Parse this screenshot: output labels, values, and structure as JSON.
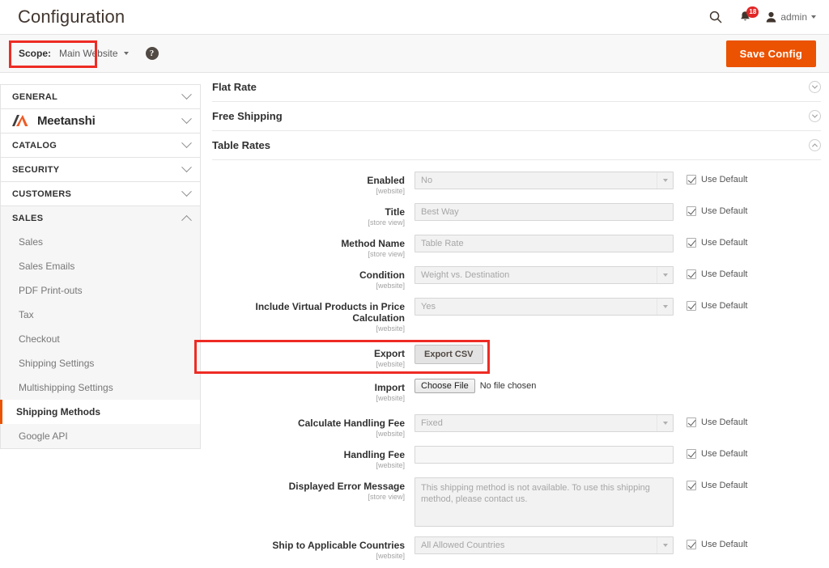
{
  "header": {
    "title": "Configuration",
    "search_icon": "search-icon",
    "notifications_icon": "bell-icon",
    "notification_count": "18",
    "user_icon": "user-icon",
    "user_label": "admin"
  },
  "scope_bar": {
    "label": "Scope:",
    "value": "Main Website",
    "help_icon": "question-mark-icon",
    "save_label": "Save Config",
    "accent_color": "#eb5202",
    "highlight_color": "#ee2b24"
  },
  "sidebar": {
    "sections": [
      {
        "label": "GENERAL",
        "expanded": false
      },
      {
        "label": "Meetanshi",
        "expanded": false,
        "is_logo": true
      },
      {
        "label": "CATALOG",
        "expanded": false
      },
      {
        "label": "SECURITY",
        "expanded": false
      },
      {
        "label": "CUSTOMERS",
        "expanded": false
      },
      {
        "label": "SALES",
        "expanded": true
      }
    ],
    "sales_items": [
      {
        "label": "Sales",
        "active": false
      },
      {
        "label": "Sales Emails",
        "active": false
      },
      {
        "label": "PDF Print-outs",
        "active": false
      },
      {
        "label": "Tax",
        "active": false
      },
      {
        "label": "Checkout",
        "active": false
      },
      {
        "label": "Shipping Settings",
        "active": false
      },
      {
        "label": "Multishipping Settings",
        "active": false
      },
      {
        "label": "Shipping Methods",
        "active": true
      },
      {
        "label": "Google API",
        "active": false
      }
    ]
  },
  "main": {
    "sections": [
      {
        "title": "Flat Rate",
        "expanded": false
      },
      {
        "title": "Free Shipping",
        "expanded": false
      },
      {
        "title": "Table Rates",
        "expanded": true
      }
    ],
    "use_default_label": "Use Default",
    "fields": [
      {
        "label": "Enabled",
        "scope": "[website]",
        "type": "select",
        "value": "No",
        "use_default": true
      },
      {
        "label": "Title",
        "scope": "[store view]",
        "type": "input",
        "value": "Best Way",
        "use_default": true
      },
      {
        "label": "Method Name",
        "scope": "[store view]",
        "type": "input",
        "value": "Table Rate",
        "use_default": true
      },
      {
        "label": "Condition",
        "scope": "[website]",
        "type": "select",
        "value": "Weight vs. Destination",
        "use_default": true
      },
      {
        "label": "Include Virtual Products in Price Calculation",
        "scope": "[website]",
        "type": "select",
        "value": "Yes",
        "use_default": true
      },
      {
        "label": "Export",
        "scope": "[website]",
        "type": "button",
        "value": "Export CSV",
        "use_default": false,
        "highlighted": true
      },
      {
        "label": "Import",
        "scope": "[website]",
        "type": "file",
        "value": "Choose File",
        "file_status": "No file chosen",
        "use_default": false
      },
      {
        "label": "Calculate Handling Fee",
        "scope": "[website]",
        "type": "select",
        "value": "Fixed",
        "use_default": true
      },
      {
        "label": "Handling Fee",
        "scope": "[website]",
        "type": "input",
        "value": "",
        "use_default": true
      },
      {
        "label": "Displayed Error Message",
        "scope": "[store view]",
        "type": "textarea",
        "value": "This shipping method is not available. To use this shipping method, please contact us.",
        "use_default": true
      },
      {
        "label": "Ship to Applicable Countries",
        "scope": "[website]",
        "type": "select",
        "value": "All Allowed Countries",
        "use_default": true
      }
    ]
  }
}
